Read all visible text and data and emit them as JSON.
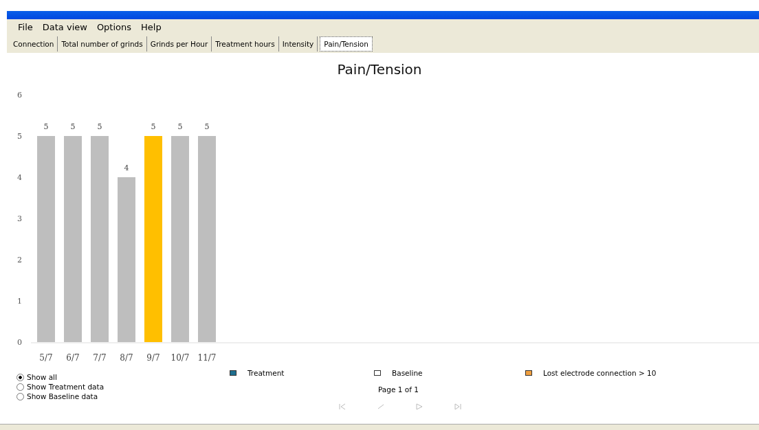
{
  "menu": [
    "File",
    "Data view",
    "Options",
    "Help"
  ],
  "tabs": [
    {
      "label": "Connection",
      "selected": false
    },
    {
      "label": "Total number of grinds",
      "selected": false
    },
    {
      "label": "Grinds per Hour",
      "selected": false
    },
    {
      "label": "Treatment hours",
      "selected": false
    },
    {
      "label": "Intensity",
      "selected": false
    },
    {
      "label": "Pain/Tension",
      "selected": true
    }
  ],
  "chart": {
    "chart_data": {
      "type": "bar",
      "title": "Pain/Tension",
      "categories": [
        "5/7",
        "6/7",
        "7/7",
        "8/7",
        "9/7",
        "10/7",
        "11/7"
      ],
      "stacked": true,
      "ylim": [
        0,
        6
      ],
      "yticks": [
        0,
        1,
        2,
        3,
        4,
        5,
        6
      ],
      "data_labels": true,
      "series": [
        {
          "color": "#bebebe",
          "values": [
            5,
            5,
            5,
            4,
            null,
            5,
            5
          ]
        },
        {
          "color": "#ffbf00",
          "values": [
            null,
            null,
            null,
            null,
            5,
            null,
            null
          ]
        }
      ]
    }
  },
  "legend": [
    {
      "label": "Treatment",
      "color": "#1f6f8f"
    },
    {
      "label": "Baseline",
      "color": "#ffffff"
    },
    {
      "label": "Lost electrode connection > 10",
      "color": "#f0a040"
    }
  ],
  "filters": [
    {
      "label": "Show all",
      "selected": true
    },
    {
      "label": "Show Treatment data",
      "selected": false
    },
    {
      "label": "Show Baseline data",
      "selected": false
    }
  ],
  "pager": {
    "text": "Page 1 of 1",
    "buttons": [
      {
        "kind": "first",
        "disabled": true
      },
      {
        "kind": "prev",
        "disabled": true
      },
      {
        "kind": "next",
        "disabled": true
      },
      {
        "kind": "last",
        "disabled": true
      }
    ]
  }
}
